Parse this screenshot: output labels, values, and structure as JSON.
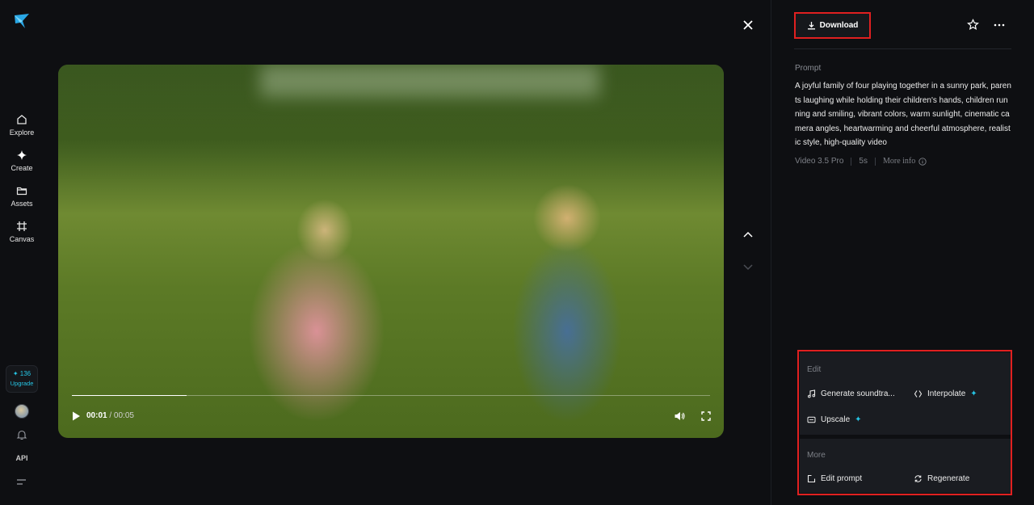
{
  "rail": {
    "items": [
      {
        "label": "Explore",
        "icon": "home-icon"
      },
      {
        "label": "Create",
        "icon": "sparkle-icon"
      },
      {
        "label": "Assets",
        "icon": "folder-icon"
      },
      {
        "label": "Canvas",
        "icon": "canvas-icon"
      }
    ],
    "credits": "✦ 136",
    "upgrade": "Upgrade",
    "api": "API"
  },
  "player": {
    "current_time": "00:01",
    "total_time": "/ 00:05",
    "progress": 0.18
  },
  "panel": {
    "download_label": "Download",
    "prompt_label": "Prompt",
    "prompt_text": "A joyful family of four playing together in a sunny park, parents laughing while holding their children's hands, children running and smiling, vibrant colors, warm sunlight, cinematic camera angles, heartwarming and cheerful atmosphere, realistic style, high-quality video",
    "model": "Video 3.5 Pro",
    "duration": "5s",
    "more_info": "More info"
  },
  "actions": {
    "edit_title": "Edit",
    "generate_soundtrack": "Generate soundtra...",
    "interpolate": "Interpolate",
    "upscale": "Upscale",
    "more_title": "More",
    "edit_prompt": "Edit prompt",
    "regenerate": "Regenerate"
  },
  "colors": {
    "accent": "#26c6e6",
    "highlight_border": "#e02020",
    "background": "#0e0f12"
  }
}
